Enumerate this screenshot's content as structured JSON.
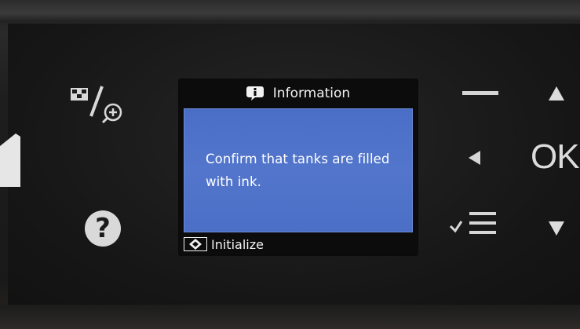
{
  "lcd": {
    "header_icon": "info-icon",
    "title": "Information",
    "message": "Confirm that tanks are filled with ink.",
    "footer_key_icon": "start-diamond-icon",
    "footer_label": "Initialize",
    "screen_color": "#4f73c9"
  },
  "buttons": {
    "home_icon": "home-icon",
    "preview_icon": "preview-zoom-icon",
    "help_label": "?",
    "minus_icon": "minus-icon",
    "left_icon": "left-arrow-icon",
    "list_icon": "checklist-icon",
    "up_icon": "up-arrow-icon",
    "ok_label": "OK",
    "down_icon": "down-arrow-icon"
  }
}
